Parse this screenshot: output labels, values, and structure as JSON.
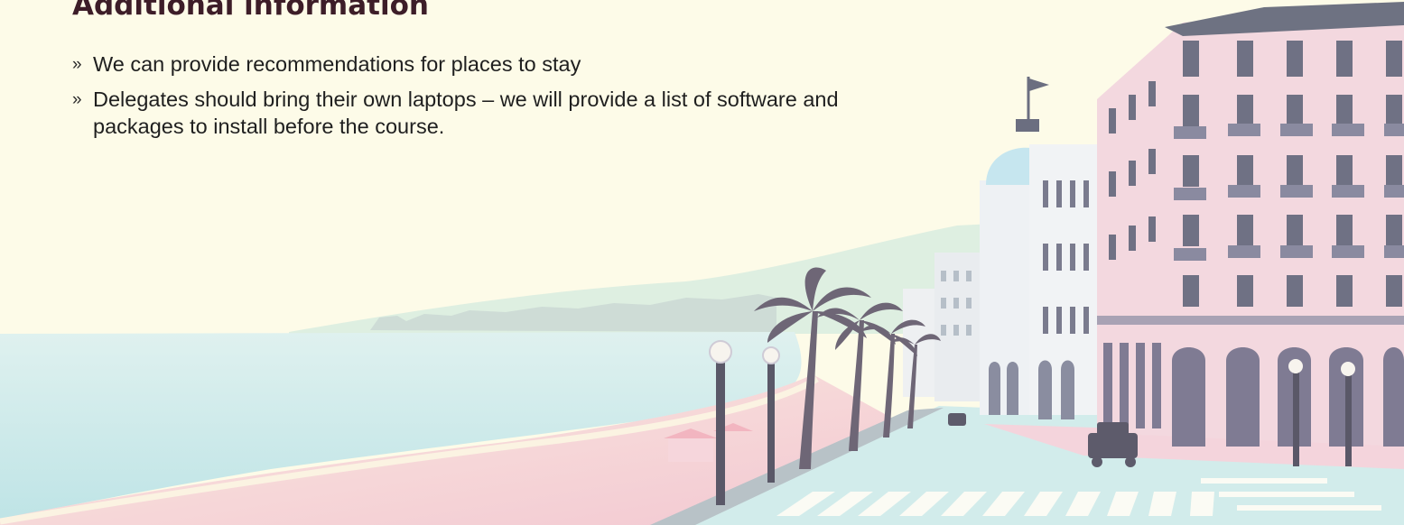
{
  "heading": "Additional information",
  "bullet_marker": "»",
  "bullets": [
    "We can provide recommendations for places to stay",
    "Delegates should bring their own laptops – we will provide a list of software and packages to install before the course."
  ],
  "colors": {
    "background": "#fdfbe8",
    "heading": "#3d1d28",
    "text": "#1f1f1f",
    "sea": "#cde9ea",
    "beach": "#f4cbd4",
    "building": "#f3d8df",
    "palm": "#6e6676"
  },
  "illustration": {
    "subject": "seaside-promenade-with-domed-hotel-and-palm-trees",
    "icon": "illustration-image"
  }
}
